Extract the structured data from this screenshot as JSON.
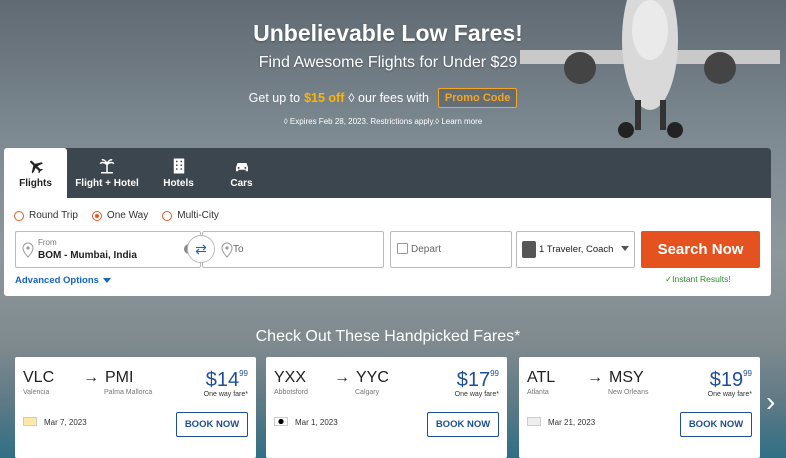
{
  "hero": {
    "title": "Unbelievable Low Fares!",
    "subtitle": "Find Awesome Flights for Under $29",
    "promo_prefix": "Get up to",
    "promo_amount": "$15 off",
    "promo_suffix": "◊ our fees with",
    "promo_button": "Promo Code",
    "expires": "◊ Expires Feb 28, 2023. Restrictions apply.◊ Learn more"
  },
  "tabs": [
    {
      "label": "Flights",
      "icon": "plane-icon",
      "active": true
    },
    {
      "label": "Flight + Hotel",
      "icon": "palm-tree-icon",
      "active": false
    },
    {
      "label": "Hotels",
      "icon": "building-icon",
      "active": false
    },
    {
      "label": "Cars",
      "icon": "car-icon",
      "active": false
    }
  ],
  "trip_types": [
    {
      "label": "Round Trip",
      "selected": false
    },
    {
      "label": "One Way",
      "selected": true
    },
    {
      "label": "Multi-City",
      "selected": false
    }
  ],
  "form": {
    "from_label": "From",
    "from_value": "BOM - Mumbai, India",
    "to_placeholder": "To",
    "depart_placeholder": "Depart",
    "travelers": "1 Traveler, Coach",
    "search_button": "Search Now",
    "advanced": "Advanced Options",
    "instant": "✓Instant Results!"
  },
  "handpicked_title": "Check Out These Handpicked Fares*",
  "deals": [
    {
      "from": "VLC",
      "to": "PMI",
      "from_city": "Valencia",
      "to_city": "Palma Mallorca",
      "price": "$14",
      "cents": "99",
      "fare_label": "One way fare*",
      "date": "Mar 7, 2023",
      "book": "BOOK NOW"
    },
    {
      "from": "YXX",
      "to": "YYC",
      "from_city": "Abbotsford",
      "to_city": "Calgary",
      "price": "$17",
      "cents": "99",
      "fare_label": "One way fare*",
      "date": "Mar 1, 2023",
      "book": "BOOK NOW"
    },
    {
      "from": "ATL",
      "to": "MSY",
      "from_city": "Atlanta",
      "to_city": "New Orleans",
      "price": "$19",
      "cents": "99",
      "fare_label": "One way fare*",
      "date": "Mar 21, 2023",
      "book": "BOOK NOW"
    }
  ],
  "colors": {
    "accent": "#e4521f",
    "link": "#1565c0",
    "price": "#1f4e96",
    "tabbar": "#3c464e"
  }
}
